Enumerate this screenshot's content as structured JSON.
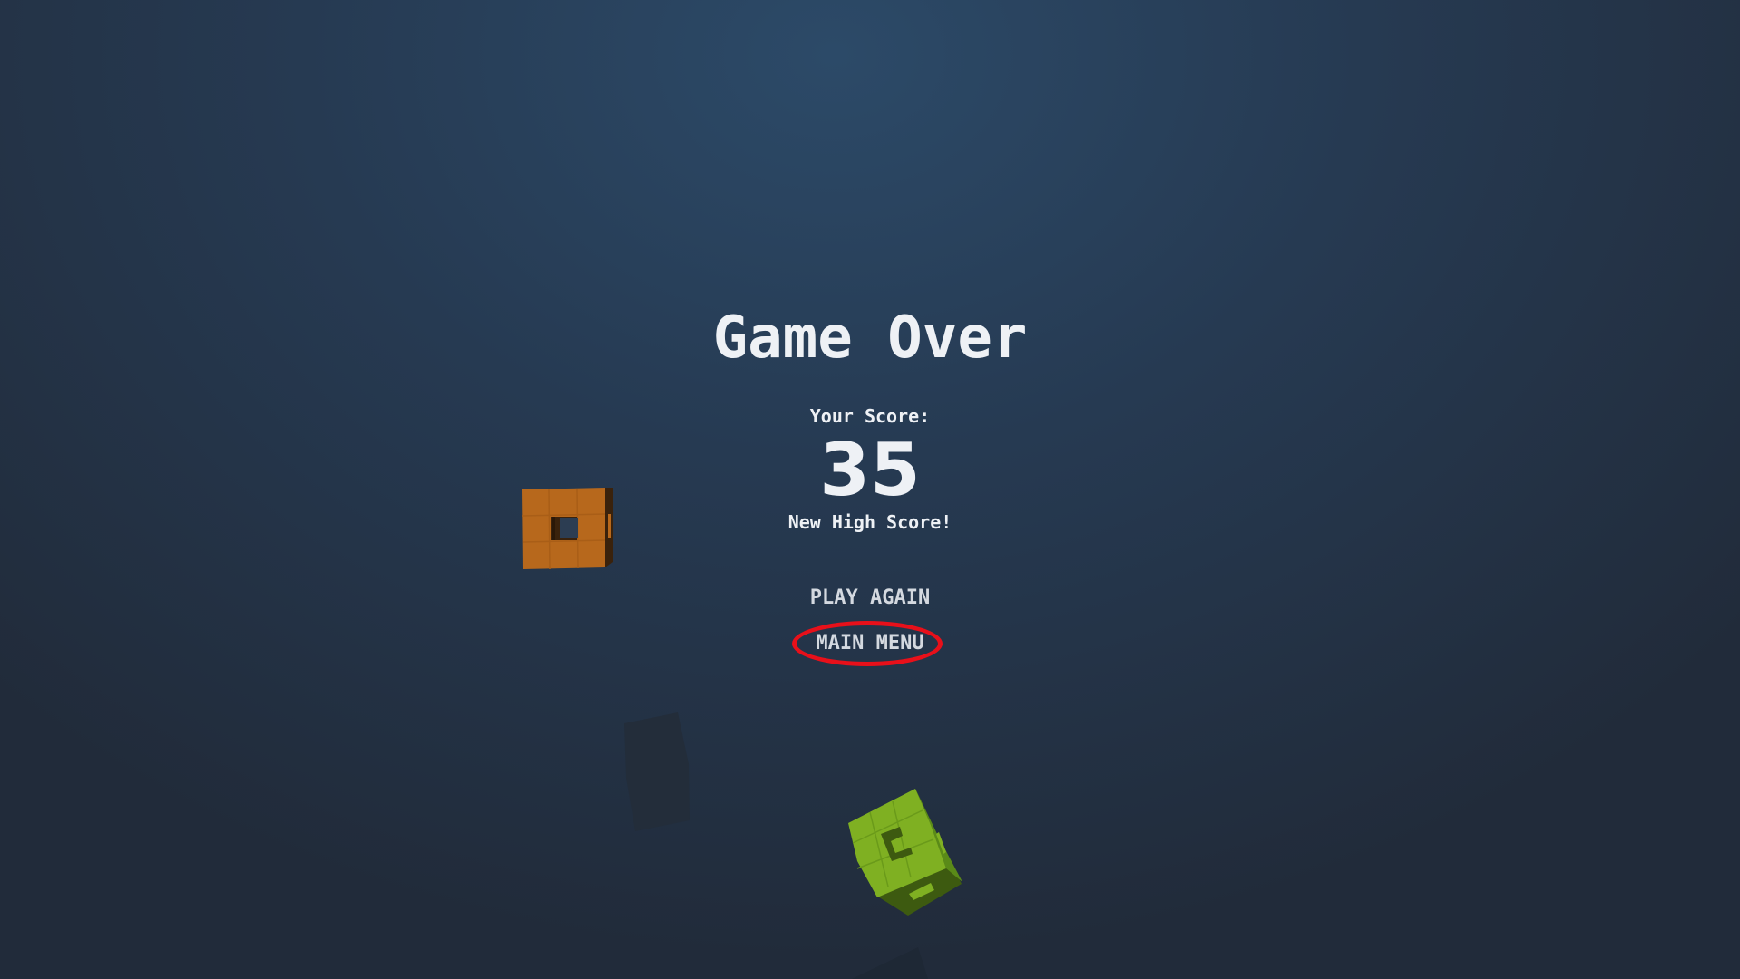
{
  "game_over": {
    "title": "Game Over",
    "score_label": "Your Score:",
    "score_value": "35",
    "high_score_message": "New High Score!"
  },
  "menu": {
    "play_again_label": "PLAY AGAIN",
    "main_menu_label": "MAIN MENU"
  },
  "colors": {
    "background": "#263a52",
    "text": "#eef1f5",
    "highlight_ring": "#e8101a",
    "orange_cube": "#b7681c",
    "green_cube": "#7fb022",
    "dark_block": "#232d3a"
  }
}
